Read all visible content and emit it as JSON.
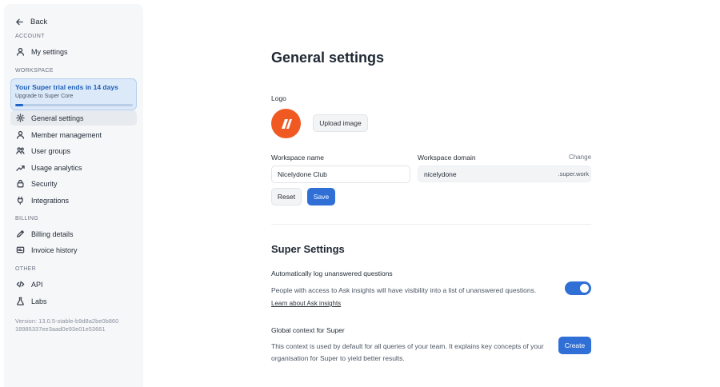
{
  "sidebar": {
    "back_label": "Back",
    "sections": {
      "account": "ACCOUNT",
      "workspace": "WORKSPACE",
      "billing": "BILLING",
      "other": "OTHER"
    },
    "account_items": [
      {
        "label": "My settings",
        "icon": "person-icon"
      }
    ],
    "trial": {
      "title": "Your Super trial ends in 14 days",
      "subtitle": "Upgrade to Super Core",
      "progress": 0.07
    },
    "workspace_items": [
      {
        "label": "General settings",
        "icon": "gear-icon",
        "active": true
      },
      {
        "label": "Member management",
        "icon": "person-icon"
      },
      {
        "label": "User groups",
        "icon": "users-icon"
      },
      {
        "label": "Usage analytics",
        "icon": "trend-icon"
      },
      {
        "label": "Security",
        "icon": "lock-icon"
      },
      {
        "label": "Integrations",
        "icon": "plug-icon"
      }
    ],
    "billing_items": [
      {
        "label": "Billing details",
        "icon": "pen-icon"
      },
      {
        "label": "Invoice history",
        "icon": "receipt-icon"
      }
    ],
    "other_items": [
      {
        "label": "API",
        "icon": "code-icon"
      },
      {
        "label": "Labs",
        "icon": "flask-icon"
      }
    ],
    "version": "Version: 13.0.5-stable-b9d8a2be0b860 18985337ee3aad0e93e01e53661"
  },
  "main": {
    "title": "General settings",
    "logo_label": "Logo",
    "upload_button": "Upload image",
    "workspace_name_label": "Workspace name",
    "workspace_name_value": "Nicelydone Club",
    "workspace_domain_label": "Workspace domain",
    "change_link": "Change",
    "domain_value": "nicelydone",
    "domain_suffix": ".super.work",
    "reset_button": "Reset",
    "save_button": "Save",
    "super_settings": {
      "title": "Super Settings",
      "auto_log_heading": "Automatically log unanswered questions",
      "auto_log_desc": "People with access to Ask insights will have visibility into a list of unanswered questions.",
      "auto_log_link": "Learn about Ask insights",
      "auto_log_enabled": true,
      "global_context_heading": "Global context for Super",
      "global_context_desc_line1": "This context is used by default for all queries of your team. It explains key concepts of your",
      "global_context_desc_line2": "organisation for Super to yield better results.",
      "create_button": "Create"
    }
  },
  "colors": {
    "accent": "#2f6fd6",
    "logo": "#f05a22",
    "trial_bg": "#dce9f9"
  }
}
